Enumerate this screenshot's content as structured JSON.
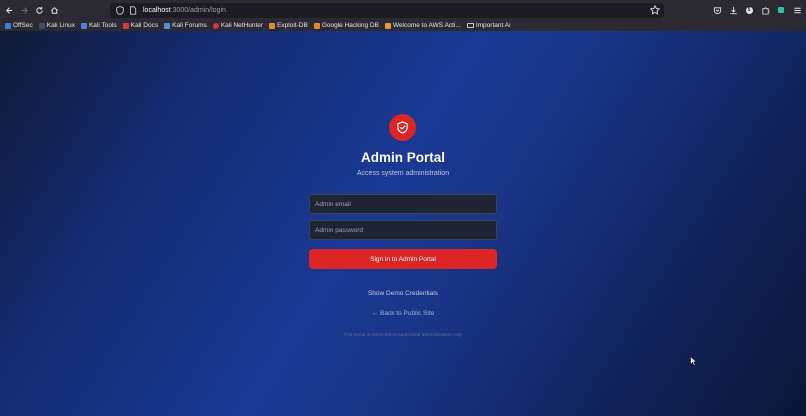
{
  "browser": {
    "url_host": "localhost",
    "url_path": ":3000/admin/login",
    "download_badge": "5",
    "bookmarks": [
      {
        "label": "OffSec",
        "color": "#3d7bd9"
      },
      {
        "label": "Kali Linux",
        "color": "#3f4a63"
      },
      {
        "label": "Kali Tools",
        "color": "#4f7fd6"
      },
      {
        "label": "Kali Docs",
        "color": "#d43a3a"
      },
      {
        "label": "Kali Forums",
        "color": "#4a8fe0"
      },
      {
        "label": "Kali NetHunter",
        "color": "#c93a3a"
      },
      {
        "label": "Exploit-DB",
        "color": "#e08a2a"
      },
      {
        "label": "Google Hacking DB",
        "color": "#e08a2a"
      },
      {
        "label": "Welcome to AWS Acti...",
        "color": "#e89b2f"
      },
      {
        "label": "Important Ai",
        "color": "folder"
      }
    ]
  },
  "page": {
    "logo_icon": "shield-check-icon",
    "title": "Admin Portal",
    "subtitle": "Access system administration",
    "email_placeholder": "Admin email",
    "password_placeholder": "Admin password",
    "submit_label": "Sign in to Admin Portal",
    "demo_link": "Show Demo Credentials",
    "back_link": "← Back to Public Site",
    "notice": "This portal is restricted to authorized administrators only."
  },
  "colors": {
    "accent": "#dc2626",
    "input_bg": "#1f2433",
    "bg_mid": "#1a3994"
  }
}
